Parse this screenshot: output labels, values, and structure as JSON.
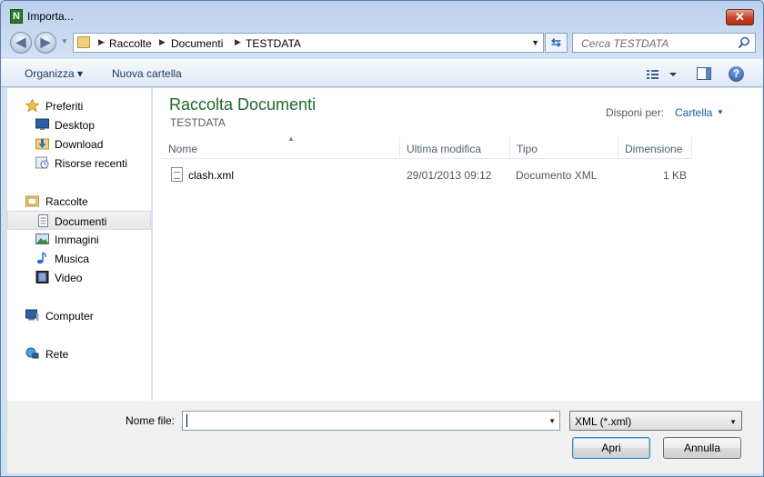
{
  "window": {
    "title": "Importa..."
  },
  "address": {
    "crumbs": [
      "Raccolte",
      "Documenti",
      "TESTDATA"
    ],
    "search_placeholder": "Cerca TESTDATA"
  },
  "toolbar": {
    "organize_label": "Organizza ▾",
    "new_folder_label": "Nuova cartella"
  },
  "nav": {
    "groups": [
      {
        "label": "Preferiti",
        "items": [
          "Desktop",
          "Download",
          "Risorse recenti"
        ]
      },
      {
        "label": "Raccolte",
        "items": [
          "Documenti",
          "Immagini",
          "Musica",
          "Video"
        ]
      },
      {
        "label": "Computer",
        "items": []
      },
      {
        "label": "Rete",
        "items": []
      }
    ],
    "selected": "Documenti"
  },
  "content": {
    "library_title": "Raccolta Documenti",
    "library_subtitle": "TESTDATA",
    "arrange_label": "Disponi per:",
    "arrange_value": "Cartella",
    "columns": [
      "Nome",
      "Ultima modifica",
      "Tipo",
      "Dimensione"
    ],
    "files": [
      {
        "name": "clash.xml",
        "modified": "29/01/2013 09:12",
        "type": "Documento XML",
        "size": "1 KB"
      }
    ]
  },
  "footer": {
    "filename_label": "Nome file:",
    "filename_value": "",
    "filetype_value": "XML (*.xml)",
    "open_label": "Apri",
    "cancel_label": "Annulla"
  },
  "colors": {
    "accent_green": "#1e6a2e",
    "link_blue": "#1e5aa6",
    "close_red": "#c7452c"
  }
}
